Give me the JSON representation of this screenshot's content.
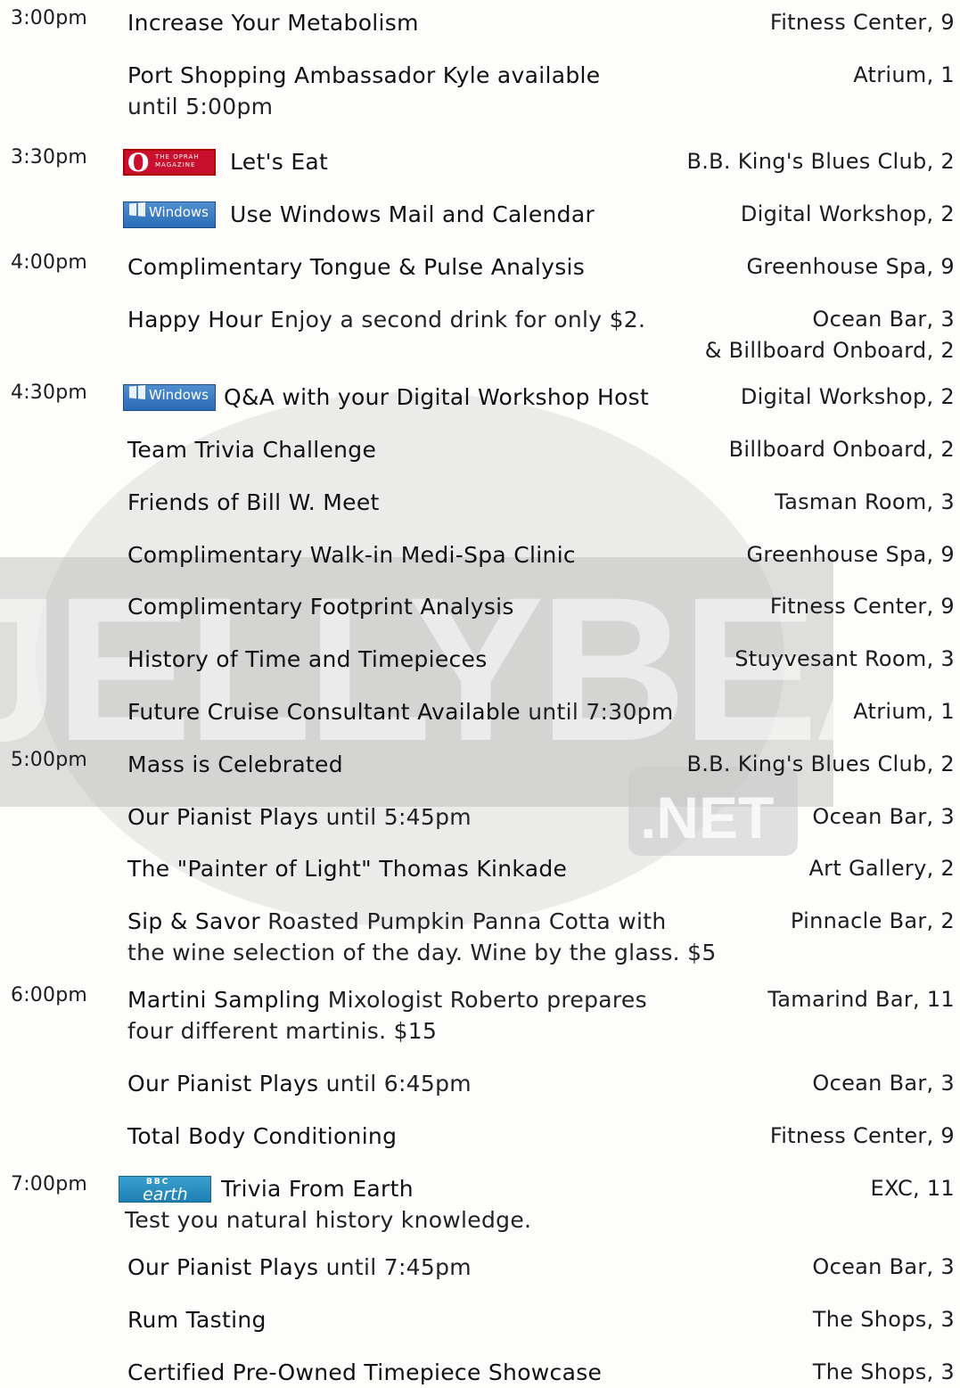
{
  "watermark": {
    "text": "JELLYBEANS",
    "suffix": ".NET"
  },
  "rows": [
    {
      "time": "3:00pm",
      "title": "Increase Your Metabolism",
      "desc": "",
      "desc2": "",
      "loc": "Fitness Center, 9",
      "loc2": ""
    },
    {
      "time": "",
      "title": "Port Shopping Ambassador Kyle available",
      "desc": "",
      "desc2": "until 5:00pm",
      "loc": "Atrium, 1",
      "loc2": ""
    },
    {
      "time": "3:30pm",
      "icon": "oprah",
      "title": "Let's Eat",
      "desc": "",
      "desc2": "",
      "loc": "B.B. King's Blues Club, 2",
      "loc2": ""
    },
    {
      "time": "",
      "icon": "windows",
      "title": "Use Windows Mail and Calendar",
      "desc": "",
      "desc2": "",
      "loc": "Digital Workshop, 2",
      "loc2": ""
    },
    {
      "time": "4:00pm",
      "title": "Complimentary Tongue & Pulse Analysis",
      "desc": "",
      "desc2": "",
      "loc": "Greenhouse Spa, 9",
      "loc2": ""
    },
    {
      "time": "",
      "title": "Happy Hour",
      "desc": "Enjoy a second drink for only $2.",
      "desc2": "",
      "loc": "Ocean Bar, 3",
      "loc2": "&  Billboard Onboard, 2"
    },
    {
      "time": "4:30pm",
      "icon": "windows",
      "title": "Q&A with your Digital Workshop Host",
      "desc": "",
      "desc2": "",
      "loc": "Digital Workshop, 2",
      "loc2": ""
    },
    {
      "time": "",
      "title": "Team Trivia Challenge",
      "desc": "",
      "desc2": "",
      "loc": "Billboard Onboard, 2",
      "loc2": ""
    },
    {
      "time": "",
      "title": "Friends of Bill W. Meet",
      "desc": "",
      "desc2": "",
      "loc": "Tasman Room, 3",
      "loc2": ""
    },
    {
      "time": "",
      "title": "Complimentary Walk-in Medi-Spa Clinic",
      "desc": "",
      "desc2": "",
      "loc": "Greenhouse Spa, 9",
      "loc2": ""
    },
    {
      "time": "",
      "title": "Complimentary Footprint Analysis",
      "desc": "",
      "desc2": "",
      "loc": "Fitness Center, 9",
      "loc2": ""
    },
    {
      "time": "",
      "title": "History of Time and Timepieces",
      "desc": "",
      "desc2": "",
      "loc": "Stuyvesant Room, 3",
      "loc2": ""
    },
    {
      "time": "",
      "title": "Future Cruise Consultant Available",
      "desc": "until 7:30pm",
      "desc2": "",
      "loc": "Atrium, 1",
      "loc2": ""
    },
    {
      "time": "5:00pm",
      "title": "Mass is Celebrated",
      "desc": "",
      "desc2": "",
      "loc": "B.B. King's Blues Club, 2",
      "loc2": ""
    },
    {
      "time": "",
      "title": "Our Pianist Plays",
      "desc": "until 5:45pm",
      "desc2": "",
      "loc": "Ocean Bar, 3",
      "loc2": ""
    },
    {
      "time": "",
      "title": "The \"Painter of Light\" Thomas Kinkade",
      "desc": "",
      "desc2": "",
      "loc": "Art Gallery, 2",
      "loc2": ""
    },
    {
      "time": "",
      "title": "Sip & Savor",
      "desc": "Roasted Pumpkin Panna Cotta with",
      "desc2": "the wine selection of the day. Wine by the glass. $5",
      "loc": "Pinnacle Bar, 2",
      "loc2": ""
    },
    {
      "time": "6:00pm",
      "title": "Martini Sampling",
      "desc": "Mixologist Roberto prepares",
      "desc2": "four different martinis. $15",
      "loc": "Tamarind Bar, 11",
      "loc2": ""
    },
    {
      "time": "",
      "title": "Our Pianist Plays",
      "desc": "until 6:45pm",
      "desc2": "",
      "loc": "Ocean Bar, 3",
      "loc2": ""
    },
    {
      "time": "",
      "title": "Total Body Conditioning",
      "desc": "",
      "desc2": "",
      "loc": "Fitness Center, 9",
      "loc2": ""
    },
    {
      "time": "7:00pm",
      "icon": "bbc-earth",
      "title": "Trivia From Earth",
      "desc": "",
      "desc2": "Test you natural history knowledge.",
      "loc": "EXC, 11",
      "loc2": ""
    },
    {
      "time": "",
      "title": "Our Pianist Plays",
      "desc": "until 7:45pm",
      "desc2": "",
      "loc": "Ocean Bar, 3",
      "loc2": ""
    },
    {
      "time": "",
      "title": "Rum Tasting",
      "desc": "",
      "desc2": "",
      "loc": "The Shops, 3",
      "loc2": ""
    },
    {
      "time": "",
      "title": "Certified Pre-Owned Timepiece Showcase",
      "desc": "",
      "desc2": "",
      "loc": "The Shops, 3",
      "loc2": ""
    }
  ],
  "logos": {
    "oprah_letter": "O",
    "oprah_text": "THE OPRAH MAGAZINE",
    "windows_text": "Windows",
    "bbc_text": "BBC",
    "earth_text": "earth"
  }
}
